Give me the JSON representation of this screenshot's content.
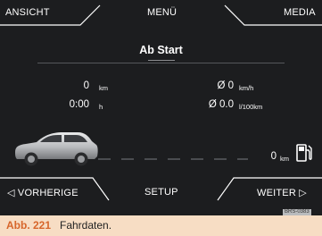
{
  "top_bar": {
    "left_label": "ANSICHT",
    "center_label": "MENÜ",
    "right_label": "MEDIA"
  },
  "page_title": "Ab Start",
  "trip": {
    "distance_value": "0",
    "distance_unit": "km",
    "time_value": "0:00",
    "time_unit": "h",
    "avg_speed_value": "Ø 0",
    "avg_speed_unit": "km/h",
    "avg_consumption_value": "Ø 0.0",
    "avg_consumption_unit": "l/100km",
    "range_value": "0",
    "range_unit": "km"
  },
  "bottom_bar": {
    "left_label": "◁  VORHERIGE",
    "center_label": "SETUP",
    "right_label": "WEITER  ▷"
  },
  "icons": {
    "car": "car-side-icon",
    "fuel": "fuel-pump-icon"
  },
  "reference_code": "BRS-0383",
  "caption": {
    "number": "Abb. 221",
    "text": "Fahrdaten."
  },
  "colors": {
    "screen_background": "#1c1d1f",
    "frame_lines": "#ffffff",
    "caption_background": "#f7ddc4",
    "caption_number": "#d7662b"
  }
}
